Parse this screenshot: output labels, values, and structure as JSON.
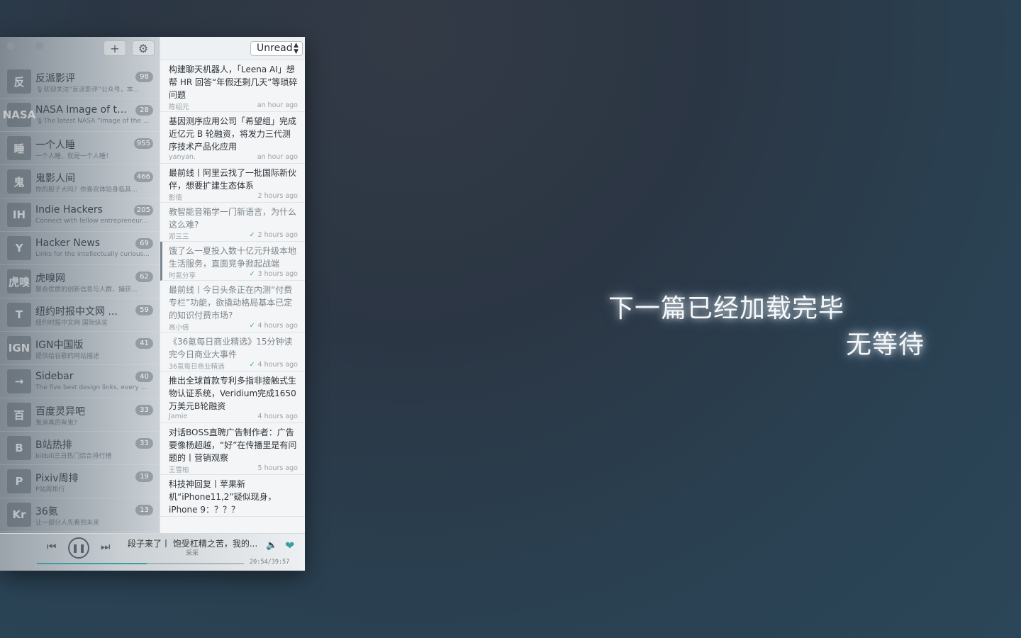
{
  "tagline": {
    "line1": "下一篇已经加载完毕",
    "line2": "无等待"
  },
  "toolbar": {
    "add_icon": "+",
    "settings_icon": "⚙"
  },
  "filter": {
    "selected": "Unread"
  },
  "feeds": [
    {
      "title": "反派影评",
      "subtitle": "🎙欢迎关注“反派影评”公众号，本...",
      "count": "98",
      "icon": "反"
    },
    {
      "title": "NASA Image of th...",
      "subtitle": "🎙The latest NASA “Image of the ...",
      "count": "28",
      "icon": "NASA"
    },
    {
      "title": "一个人睡",
      "subtitle": "一个人睡，就是一个人睡！",
      "count": "955",
      "icon": "睡"
    },
    {
      "title": "鬼影人间",
      "subtitle": "你的胆子大吗？你喜欢体验身临其...",
      "count": "466",
      "icon": "鬼"
    },
    {
      "title": "Indie Hackers",
      "subtitle": "Connect with fellow entrepreneur...",
      "count": "205",
      "icon": "IH"
    },
    {
      "title": "Hacker News",
      "subtitle": "Links for the intellectually curious...",
      "count": "69",
      "icon": "Y"
    },
    {
      "title": "虎嗅网",
      "subtitle": "聚合优质的创新信息与人群，捕获...",
      "count": "62",
      "icon": "虎嗅"
    },
    {
      "title": "纽约时报中文网 ...",
      "subtitle": "纽约时报中文网 国际纵览",
      "count": "59",
      "icon": "T"
    },
    {
      "title": "IGN中国版",
      "subtitle": "提供给谷歌的网站描述",
      "count": "41",
      "icon": "IGN"
    },
    {
      "title": "Sidebar",
      "subtitle": "The five best design links, every ...",
      "count": "40",
      "icon": "→"
    },
    {
      "title": "百度灵异吧",
      "subtitle": "鬼道真的有鬼?",
      "count": "33",
      "icon": "百"
    },
    {
      "title": "B站热排",
      "subtitle": "bilibili三日热门综合排行榜",
      "count": "33",
      "icon": "B"
    },
    {
      "title": "Pixiv周排",
      "subtitle": "P站周排行",
      "count": "19",
      "icon": "P"
    },
    {
      "title": "36氪",
      "subtitle": "让一部分人先看到未来",
      "count": "13",
      "icon": "Kr"
    }
  ],
  "articles": [
    {
      "title": "构建聊天机器人，「Leena AI」想帮 HR 回答“年假还剩几天”等琐碎问题",
      "author": "陈绍元",
      "time": "an hour ago",
      "read": false,
      "selected": false
    },
    {
      "title": "基因测序应用公司「希望组」完成近亿元 B 轮融资，将发力三代测序技术产品化应用",
      "author": "yanyan.",
      "time": "an hour ago",
      "read": false,
      "selected": false
    },
    {
      "title": "最前线丨阿里云找了一批国际新伙伴，想要扩建生态体系",
      "author": "影倩",
      "time": "2 hours ago",
      "read": false,
      "selected": false
    },
    {
      "title": "教智能音箱学一门新语言，为什么这么难?",
      "author": "邓三三",
      "time": "2 hours ago",
      "read": true,
      "selected": false
    },
    {
      "title": "饿了么一夏投入数十亿元升级本地生活服务，直面竞争掀起战端",
      "author": "时氪分享",
      "time": "3 hours ago",
      "read": true,
      "selected": true
    },
    {
      "title": "最前线丨今日头条正在内测“付费专栏”功能，欲撬动格局基本已定的知识付费市场?",
      "author": "高小倩",
      "time": "4 hours ago",
      "read": true,
      "selected": false
    },
    {
      "title": "《36氪每日商业精选》15分钟读完今日商业大事件",
      "author": "36氪每日商业精选",
      "time": "4 hours ago",
      "read": true,
      "selected": false
    },
    {
      "title": "推出全球首款专利多指非接触式生物认证系统，Veridium完成1650万美元B轮融资",
      "author": "Jamie",
      "time": "4 hours ago",
      "read": false,
      "selected": false
    },
    {
      "title": "对话BOSS直聘广告制作者：广告要像杨超越，“好”在传播里是有问题的丨营销观察",
      "author": "王雪柏",
      "time": "5 hours ago",
      "read": false,
      "selected": false
    },
    {
      "title": "科技神回复丨苹果新机“iPhone11,2”疑似现身，iPhone 9：？？？",
      "author": "",
      "time": "",
      "read": false,
      "selected": false
    }
  ],
  "player": {
    "title": "段子来了丨 饱受杠精之苦，我的...",
    "author": "采采",
    "elapsed": "20:54",
    "total": "39:57",
    "timer": "20:54/39:57",
    "progress_fraction": 0.53,
    "accent": "#3b9da3"
  }
}
